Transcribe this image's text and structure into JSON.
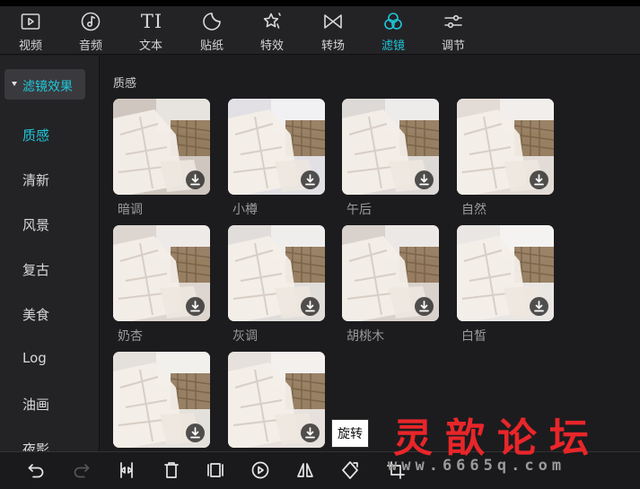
{
  "toolbar": {
    "tabs": [
      {
        "label": "视频",
        "icon": "video-icon"
      },
      {
        "label": "音频",
        "icon": "audio-icon"
      },
      {
        "label": "文本",
        "icon": "text-icon"
      },
      {
        "label": "贴纸",
        "icon": "sticker-icon"
      },
      {
        "label": "特效",
        "icon": "effects-icon"
      },
      {
        "label": "转场",
        "icon": "transition-icon"
      },
      {
        "label": "滤镜",
        "icon": "filter-icon",
        "active": true
      },
      {
        "label": "调节",
        "icon": "adjust-icon"
      }
    ],
    "text_icon_glyph": "TI",
    "active_color": "#1fc6d8"
  },
  "sidebar": {
    "header": "滤镜效果",
    "items": [
      "质感",
      "清新",
      "风景",
      "复古",
      "美食",
      "Log",
      "油画",
      "夜影"
    ],
    "active_index": 0
  },
  "content": {
    "section_title": "质感",
    "filters": [
      "暗调",
      "小樽",
      "午后",
      "自然",
      "奶杏",
      "灰调",
      "胡桃木",
      "白皙",
      "",
      ""
    ]
  },
  "bottom_toolbar": {
    "icons": [
      "undo-icon",
      "redo-icon",
      "split-icon",
      "delete-icon",
      "freeze-frame-icon",
      "reverse-icon",
      "mirror-icon",
      "rotate-icon",
      "crop-icon"
    ]
  },
  "tooltip": "旋转",
  "watermark": {
    "title": "灵歆论坛",
    "url": "www.6665q.com",
    "color": "#e8262a"
  }
}
